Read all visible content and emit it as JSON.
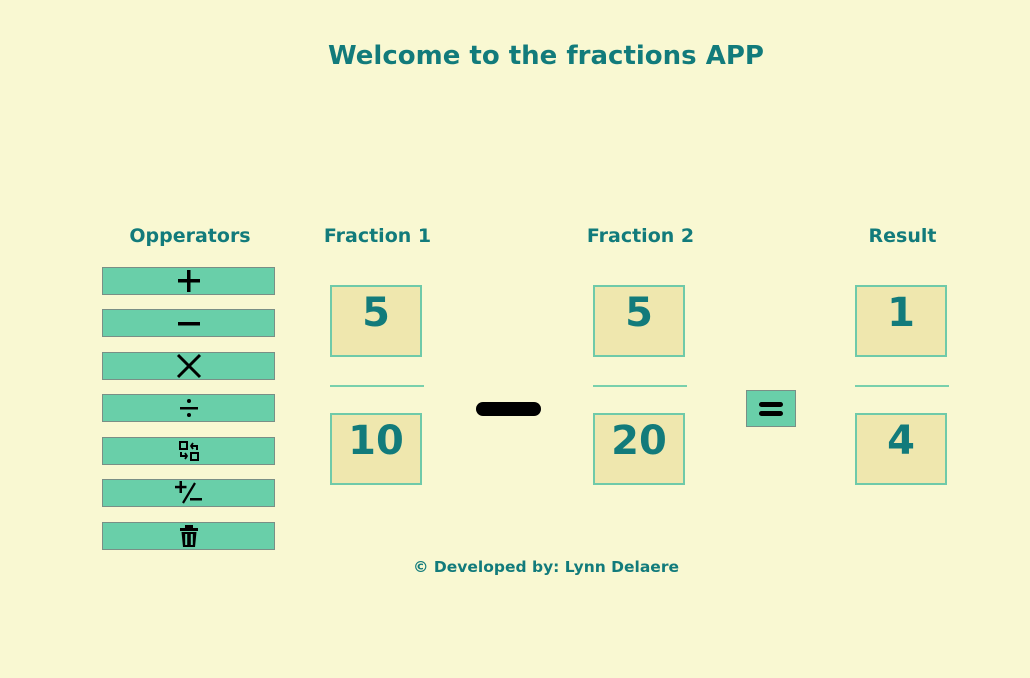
{
  "header": {
    "title": "Welcome to the fractions APP"
  },
  "columns": {
    "operators": "Opperators",
    "fraction1": "Fraction 1",
    "fraction2": "Fraction 2",
    "result": "Result"
  },
  "operators": [
    {
      "name": "add",
      "icon": "plus-icon"
    },
    {
      "name": "subtract",
      "icon": "minus-icon"
    },
    {
      "name": "multiply",
      "icon": "times-icon"
    },
    {
      "name": "divide",
      "icon": "divide-icon"
    },
    {
      "name": "swap",
      "icon": "swap-icon"
    },
    {
      "name": "negate",
      "icon": "plus-minus-icon"
    },
    {
      "name": "clear",
      "icon": "trash-icon"
    }
  ],
  "fraction1": {
    "numerator": "5",
    "denominator": "10"
  },
  "fraction2": {
    "numerator": "5",
    "denominator": "20"
  },
  "result": {
    "numerator": "1",
    "denominator": "4"
  },
  "current_operator": {
    "icon": "minus-icon"
  },
  "equals": {
    "icon": "equals-icon"
  },
  "footer": {
    "text": "© Developed by: Lynn Delaere"
  },
  "colors": {
    "background": "#f9f8d2",
    "accent": "#69cfa9",
    "text": "#127b7b",
    "box": "#efe7ae"
  }
}
